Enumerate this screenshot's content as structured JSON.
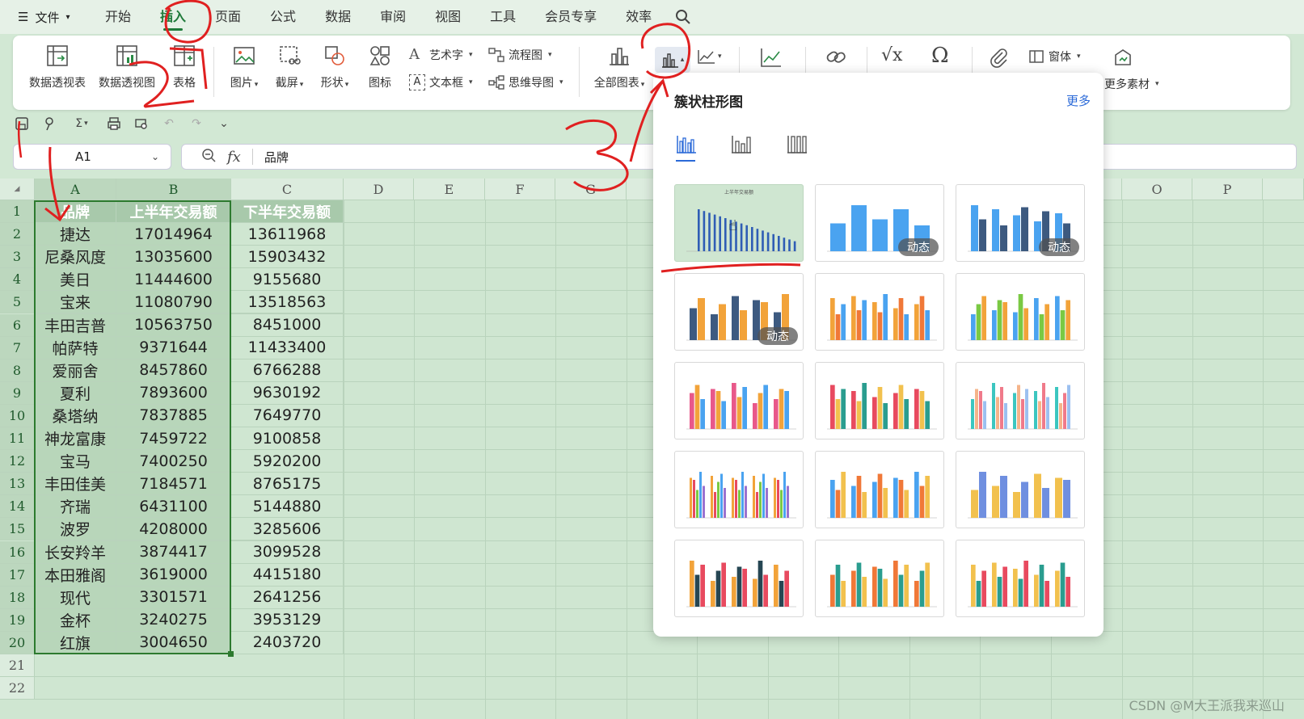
{
  "menubar": {
    "file_label": "文件",
    "tabs": [
      "开始",
      "插入",
      "页面",
      "公式",
      "数据",
      "审阅",
      "视图",
      "工具",
      "会员专享",
      "效率"
    ],
    "active_tab": "插入"
  },
  "ribbon": {
    "pivot_table": "数据透视表",
    "pivot_chart": "数据透视图",
    "table": "表格",
    "picture": "图片",
    "screenshot": "截屏",
    "shape": "形状",
    "icon": "图标",
    "wordart": "艺术字",
    "textbox": "文本框",
    "flowchart": "流程图",
    "mindmap": "思维导图",
    "all_charts": "全部图表",
    "window": "窗体",
    "more_material": "更多素材"
  },
  "namebox": {
    "value": "A1"
  },
  "formula": {
    "value": "品牌"
  },
  "columns": [
    "A",
    "B",
    "C",
    "D",
    "E",
    "F",
    "G",
    "O",
    "P"
  ],
  "rows": [
    "1",
    "2",
    "3",
    "4",
    "5",
    "6",
    "7",
    "8",
    "9",
    "10",
    "11",
    "12",
    "13",
    "14",
    "15",
    "16",
    "17",
    "18",
    "19",
    "20",
    "21",
    "22"
  ],
  "table": {
    "headers": [
      "品牌",
      "上半年交易额",
      "下半年交易额"
    ],
    "data": [
      [
        "捷达",
        "17014964",
        "13611968"
      ],
      [
        "尼桑风度",
        "13035600",
        "15903432"
      ],
      [
        "美日",
        "11444600",
        "9155680"
      ],
      [
        "宝来",
        "11080790",
        "13518563"
      ],
      [
        "丰田吉普",
        "10563750",
        "8451000"
      ],
      [
        "帕萨特",
        "9371644",
        "11433400"
      ],
      [
        "爱丽舍",
        "8457860",
        "6766288"
      ],
      [
        "夏利",
        "7893600",
        "9630192"
      ],
      [
        "桑塔纳",
        "7837885",
        "7649770"
      ],
      [
        "神龙富康",
        "7459722",
        "9100858"
      ],
      [
        "宝马",
        "7400250",
        "5920200"
      ],
      [
        "丰田佳美",
        "7184571",
        "8765175"
      ],
      [
        "齐瑞",
        "6431100",
        "5144880"
      ],
      [
        "波罗",
        "4208000",
        "3285606"
      ],
      [
        "长安羚羊",
        "3874417",
        "3099528"
      ],
      [
        "本田雅阁",
        "3619000",
        "4415180"
      ],
      [
        "现代",
        "3301571",
        "2641256"
      ],
      [
        "金杯",
        "3240275",
        "3953129"
      ],
      [
        "红旗",
        "3004650",
        "2403720"
      ]
    ]
  },
  "dropdown": {
    "title": "簇状柱形图",
    "more": "更多",
    "badge": "动态",
    "preview_title": "上半年交易额"
  },
  "annotations": [
    "1",
    "2",
    "3"
  ],
  "watermark": "CSDN @M大王派我来巡山",
  "colors": {
    "accent": "#1f7a3a",
    "selection": "#2d7a2f",
    "link": "#2b6ad8",
    "annotation": "#e02020"
  }
}
